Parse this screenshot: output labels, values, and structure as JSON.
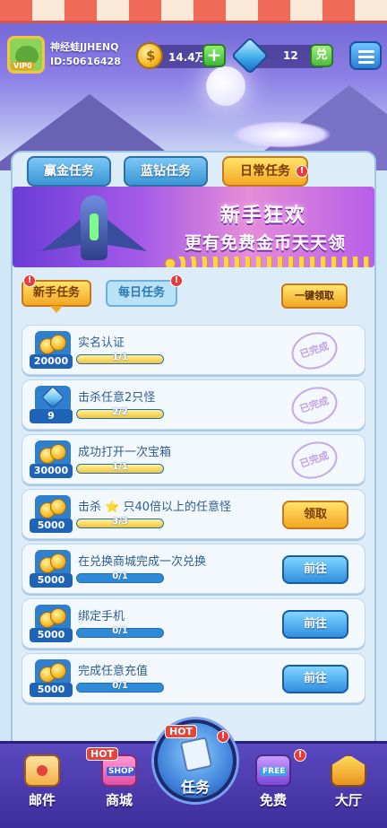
{
  "header": {
    "username": "神经蛙JJHENQ",
    "user_id": "ID:50616428",
    "avatar_badge": "VIP0",
    "coins": "14.4万",
    "gems": "12",
    "exchange_label": "兑"
  },
  "top_tabs": [
    {
      "label": "赢金任务",
      "active": false
    },
    {
      "label": "蓝钻任务",
      "active": false
    },
    {
      "label": "日常任务",
      "active": true,
      "badge": "!"
    }
  ],
  "banner": {
    "line1": "新手狂欢",
    "line2": "更有免费金币天天领"
  },
  "sub_tabs": [
    {
      "label": "新手任务",
      "active": true,
      "badge": "!"
    },
    {
      "label": "每日任务",
      "active": false,
      "badge": "!"
    }
  ],
  "claim_all_label": "一键领取",
  "tasks": [
    {
      "title": "实名认证",
      "reward_type": "coin",
      "reward": "20000",
      "progress_text": "1/1",
      "progress": 1.0,
      "status": "已完成"
    },
    {
      "title": "击杀任意2只怪",
      "reward_type": "gem",
      "reward": "9",
      "progress_text": "2/2",
      "progress": 1.0,
      "status": "已完成"
    },
    {
      "title": "成功打开一次宝箱",
      "reward_type": "coin",
      "reward": "30000",
      "progress_text": "1/1",
      "progress": 1.0,
      "status": "已完成"
    },
    {
      "title": "击杀 ⭐ 只40倍以上的任意怪",
      "reward_type": "coin",
      "reward": "5000",
      "progress_text": "3/3",
      "progress": 1.0,
      "action": "领取"
    },
    {
      "title": "在兑换商城完成一次兑换",
      "reward_type": "coin",
      "reward": "5000",
      "progress_text": "0/1",
      "progress": 0.0,
      "action": "前往"
    },
    {
      "title": "绑定手机",
      "reward_type": "coin",
      "reward": "5000",
      "progress_text": "0/1",
      "progress": 0.0,
      "action": "前往"
    },
    {
      "title": "完成任意充值",
      "reward_type": "coin",
      "reward": "5000",
      "progress_text": "0/1",
      "progress": 0.0,
      "action": "前往"
    }
  ],
  "nav": {
    "mail": "邮件",
    "shop": "商城",
    "shop_hot": "HOT",
    "shop_tag": "SHOP",
    "tasks": "任务",
    "tasks_hot": "HOT",
    "free": "免费",
    "free_tag": "FREE",
    "hall": "大厅"
  },
  "colors": {
    "accent_blue": "#2f8fe0",
    "accent_orange": "#f3a623",
    "nav_purple": "#4a3bb0"
  }
}
